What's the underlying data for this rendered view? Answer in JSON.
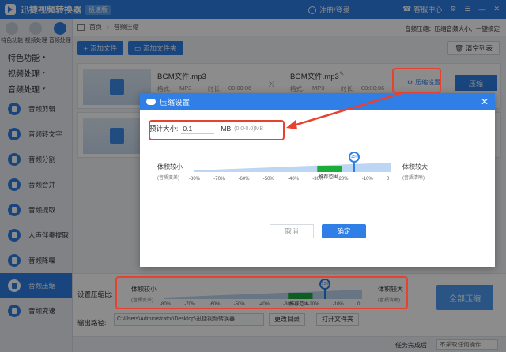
{
  "app": {
    "title": "迅捷视频转换器",
    "edition": "极速版",
    "login": "注册/登录",
    "service": "客服中心"
  },
  "sidebar": {
    "top_tools": [
      {
        "label": "特色功能"
      },
      {
        "label": "视频处理"
      },
      {
        "label": "音频处理"
      }
    ],
    "categories": [
      {
        "label": "特色功能"
      },
      {
        "label": "视频处理"
      },
      {
        "label": "音频处理"
      }
    ],
    "items": [
      {
        "label": "音频剪辑"
      },
      {
        "label": "音频转文字"
      },
      {
        "label": "音频分割"
      },
      {
        "label": "音频合并"
      },
      {
        "label": "音频提取"
      },
      {
        "label": "人声伴奏提取"
      },
      {
        "label": "音频降噪"
      },
      {
        "label": "音频压缩"
      },
      {
        "label": "音频变速"
      }
    ]
  },
  "breadcrumb": {
    "home": "首页",
    "current": "音频压缩",
    "right_hint": "音频压缩：压缩音频大小、一键搞定"
  },
  "toolbar": {
    "add_file": "添加文件",
    "add_folder": "添加文件夹",
    "clear_list": "清空列表"
  },
  "file_rows": [
    {
      "source_name": "BGM文件.mp3",
      "source_format_label": "格式:",
      "source_format": "MP3",
      "source_duration_label": "时长:",
      "source_duration": "00:00:06",
      "target_name": "BGM文件.mp3",
      "target_format_label": "格式:",
      "target_format": "MP3",
      "target_duration_label": "时长:",
      "target_duration": "00:00:06",
      "settings": "压缩设置",
      "compress": "压缩"
    }
  ],
  "bottom": {
    "ratio_label": "设置压缩比:",
    "path_label": "输出路径:",
    "path_value": "C:\\Users\\Administrator\\Desktop\\迅捷视频转换器",
    "change_dir": "更改目录",
    "open_folder": "打开文件夹",
    "all_compress": "全部压缩",
    "after_done_label": "任务完成后",
    "after_done_value": "不采取任何操作"
  },
  "slider": {
    "small_label": "体积较小",
    "small_sub": "(音质变差)",
    "big_label": "体积较大",
    "big_sub": "(音质清晰)",
    "ticks": [
      "-80%",
      "-70%",
      "-60%",
      "-50%",
      "-40%",
      "-30%",
      "-20%",
      "-10%",
      "0"
    ],
    "recommended_label": "推荐范围",
    "value": "-15%",
    "value_percent": -15,
    "recommended_range_percent": [
      -30,
      -20
    ]
  },
  "modal": {
    "title": "压缩设置",
    "size_label": "预计大小:",
    "size_value": "0.1",
    "size_unit": "MB",
    "size_range": "(0.0-0.0)MB",
    "cancel": "取消",
    "ok": "确定"
  },
  "colors": {
    "primary": "#2f7fe6",
    "highlight": "#e8412f",
    "recommended": "#1aad3a"
  }
}
